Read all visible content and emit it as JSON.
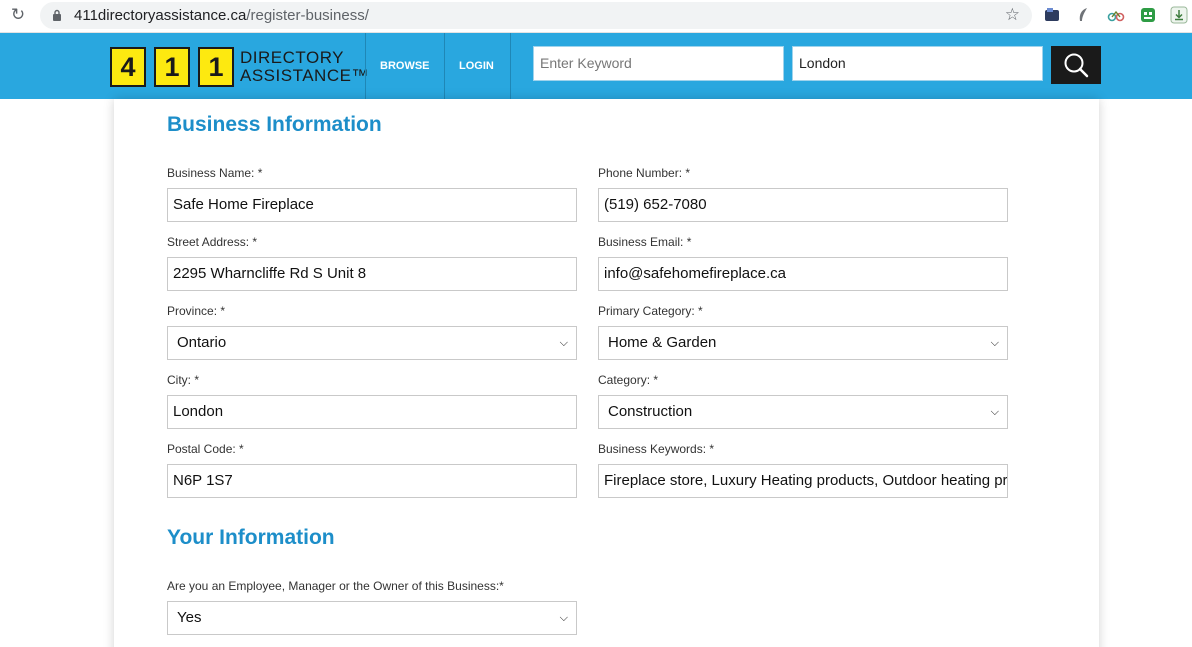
{
  "browser": {
    "url_host": "411directoryassistance.ca",
    "url_path": "/register-business/"
  },
  "header": {
    "logo_digits": [
      "4",
      "1",
      "1"
    ],
    "logo_line1": "DIRECTORY",
    "logo_line2": "ASSISTANCE™",
    "nav": {
      "browse": "BROWSE",
      "login": "LOGIN"
    },
    "keyword_placeholder": "Enter Keyword",
    "location_value": "London"
  },
  "business_info": {
    "title": "Business Information",
    "business_name": {
      "label": "Business Name: *",
      "value": "Safe Home Fireplace"
    },
    "phone_number": {
      "label": "Phone Number: *",
      "value": "(519) 652-7080"
    },
    "street_address": {
      "label": "Street Address: *",
      "value": "2295 Wharncliffe Rd S Unit 8"
    },
    "business_email": {
      "label": "Business Email: *",
      "value": "info@safehomefireplace.ca"
    },
    "province": {
      "label": "Province: *",
      "value": "Ontario"
    },
    "primary_category": {
      "label": "Primary Category: *",
      "value": "Home & Garden"
    },
    "city": {
      "label": "City: *",
      "value": "London"
    },
    "category": {
      "label": "Category: *",
      "value": "Construction"
    },
    "postal_code": {
      "label": "Postal Code: *",
      "value": "N6P 1S7"
    },
    "business_keywords": {
      "label": "Business Keywords: *",
      "value": "Fireplace store, Luxury Heating products, Outdoor heating pr"
    }
  },
  "your_info": {
    "title": "Your Information",
    "role": {
      "label": "Are you an Employee, Manager or the Owner of this Business:*",
      "value": "Yes"
    }
  },
  "colors": {
    "header_blue": "#29a7df",
    "title_blue": "#1d8ec9",
    "logo_yellow": "#fde910"
  },
  "icons": [
    "reload-icon",
    "lock-icon",
    "bookmark-star-icon",
    "search-icon",
    "chevron-down-icon"
  ]
}
